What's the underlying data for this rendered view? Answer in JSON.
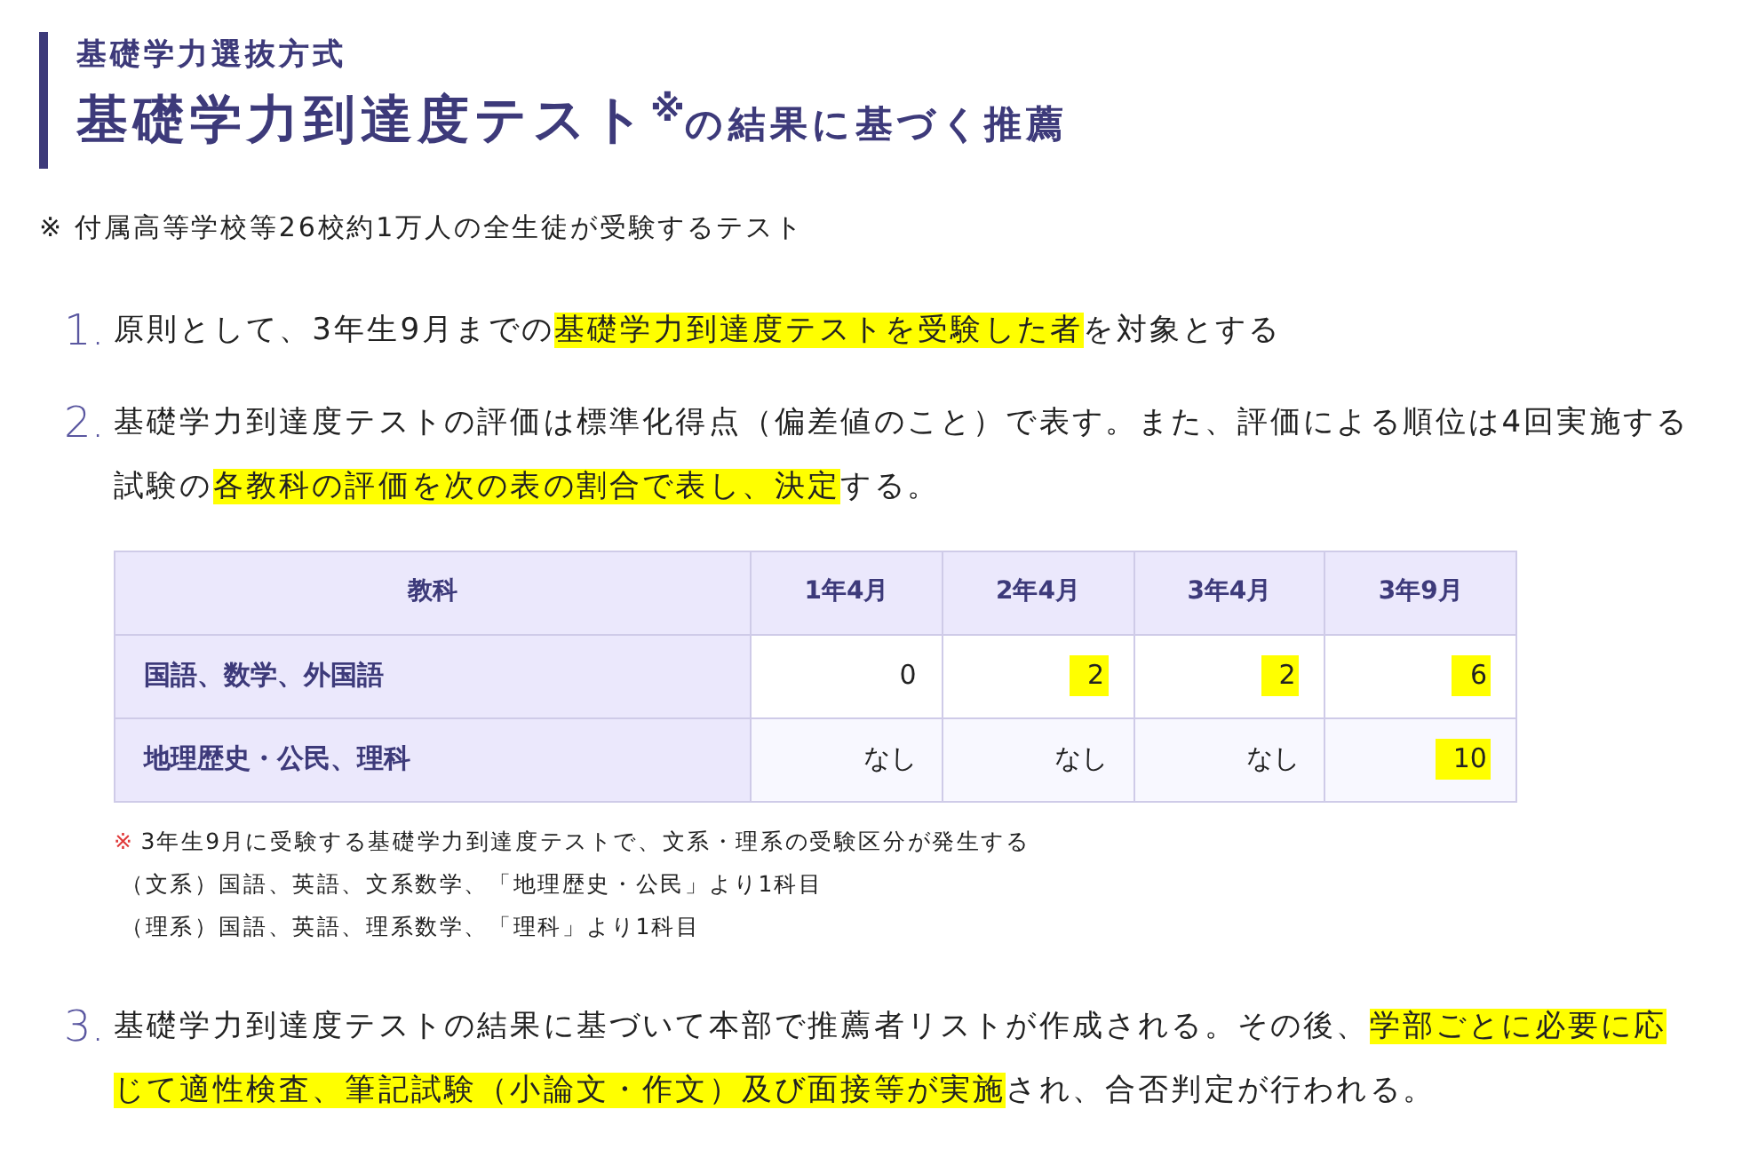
{
  "heading": {
    "subtitle": "基礎学力選抜方式",
    "title": "基礎学力到達度テスト",
    "title_mark": "※",
    "title_rest": "の結果に基づく推薦"
  },
  "footnote": "※ 付属高等学校等26校約1万人の全生徒が受験するテスト",
  "items": [
    {
      "number": "1.",
      "segments": [
        {
          "text": "原則として、3年生9月までの",
          "highlight": false
        },
        {
          "text": "基礎学力到達度テストを受験した者",
          "highlight": true
        },
        {
          "text": "を対象とする",
          "highlight": false
        }
      ]
    },
    {
      "number": "2.",
      "segments": [
        {
          "text": "基礎学力到達度テストの評価は標準化得点（偏差値のこと）で表す。また、評価による順位は4回実施する試験の",
          "highlight": false
        },
        {
          "text": "各教科の評価を次の表の割合で表し、決定",
          "highlight": true
        },
        {
          "text": "する。",
          "highlight": false
        }
      ],
      "table": {
        "columns": [
          "教科",
          "1年4月",
          "2年4月",
          "3年4月",
          "3年9月"
        ],
        "rows": [
          {
            "subject": "国語、数学、外国語",
            "cells": [
              {
                "text": "0",
                "highlight": false
              },
              {
                "text": "2",
                "highlight": true
              },
              {
                "text": "2",
                "highlight": true
              },
              {
                "text": "6",
                "highlight": true
              }
            ]
          },
          {
            "subject": "地理歴史・公民、理科",
            "cells": [
              {
                "text": "なし",
                "highlight": false
              },
              {
                "text": "なし",
                "highlight": false
              },
              {
                "text": "なし",
                "highlight": false
              },
              {
                "text": "10",
                "highlight": true
              }
            ]
          }
        ]
      },
      "notes": [
        {
          "mark": "※",
          "text": "3年生9月に受験する基礎学力到達度テストで、文系・理系の受験区分が発生する"
        },
        {
          "text": "（文系）国語、英語、文系数学、「地理歴史・公民」より1科目"
        },
        {
          "text": "（理系）国語、英語、理系数学、「理科」より1科目"
        }
      ]
    },
    {
      "number": "3.",
      "segments": [
        {
          "text": "基礎学力到達度テストの結果に基づいて本部で推薦者リストが作成される。その後、",
          "highlight": false
        },
        {
          "text": "学部ごとに必要に応じて適性検査、筆記試験（小論文・作文）及び面接等が実施",
          "highlight": true
        },
        {
          "text": "され、合否判定が行われる。",
          "highlight": false
        }
      ]
    }
  ]
}
